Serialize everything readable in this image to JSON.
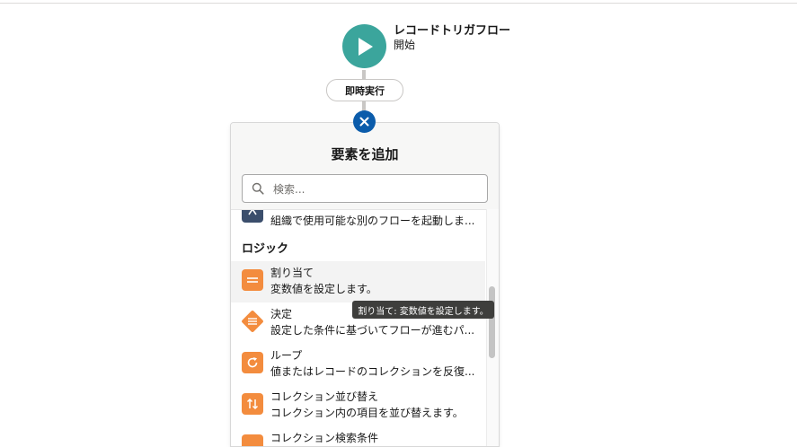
{
  "flow": {
    "start_title": "レコードトリガフロー",
    "start_subtitle": "開始",
    "path_label": "即時実行"
  },
  "panel": {
    "title": "要素を追加",
    "search_placeholder": "検索..."
  },
  "list": {
    "partial_item_desc": "組織で使用可能な別のフローを起動しま...",
    "section_logic": "ロジック",
    "items": [
      {
        "title": "割り当て",
        "desc": "変数値を設定します。",
        "icon": "assignment-icon"
      },
      {
        "title": "決定",
        "desc": "設定した条件に基づいてフローが進むパ...",
        "icon": "decision-icon"
      },
      {
        "title": "ループ",
        "desc": "値またはレコードのコレクションを反復...",
        "icon": "loop-icon"
      },
      {
        "title": "コレクション並び替え",
        "desc": "コレクション内の項目を並び替えます。",
        "icon": "collection-sort-icon"
      },
      {
        "title": "コレクション検索条件",
        "desc": "",
        "icon": "collection-filter-icon"
      }
    ]
  },
  "tooltip": "割り当て: 変数値を設定します。",
  "colors": {
    "start_node": "#3ba59c",
    "close_button": "#0b5cab",
    "logic_icon": "#f38c3e",
    "subflow_icon": "#3b4e6c"
  }
}
